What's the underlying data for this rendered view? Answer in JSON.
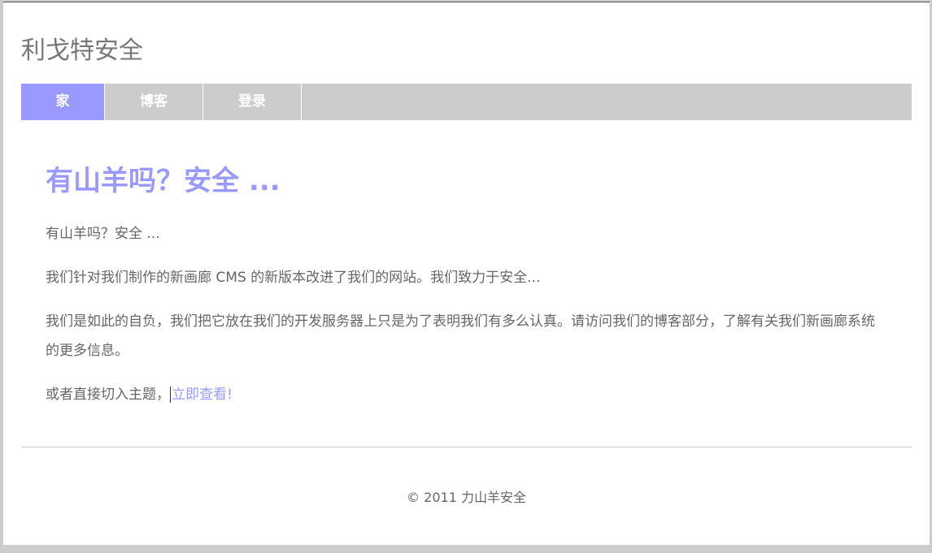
{
  "site": {
    "title": "利戈特安全"
  },
  "nav": {
    "items": [
      {
        "label": "家",
        "active": true
      },
      {
        "label": "博客",
        "active": false
      },
      {
        "label": "登录",
        "active": false
      }
    ]
  },
  "main": {
    "headline": "有山羊吗？安全 ...",
    "paragraph1": "有山羊吗？安全 ...",
    "paragraph2": "我们针对我们制作的新画廊 CMS 的新版本改进了我们的网站。我们致力于安全...",
    "paragraph3": "我们是如此的自负，我们把它放在我们的开发服务器上只是为了表明我们有多么认真。请访问我们的博客部分，了解有关我们新画廊系统的更多信息。",
    "paragraph4_prefix": "或者直接切入主题，",
    "link_label": "立即查看!"
  },
  "footer": {
    "text": "© 2011 力山羊安全"
  },
  "colors": {
    "accent": "#9999ff",
    "nav_bg": "#cccccc",
    "text": "#666666",
    "title": "#777777"
  }
}
